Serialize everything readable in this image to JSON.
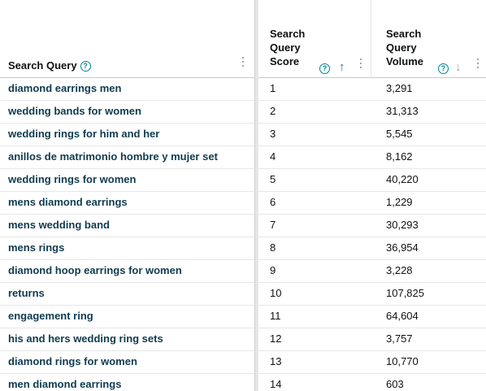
{
  "columns": {
    "query": {
      "label": "Search Query",
      "help_glyph": "?"
    },
    "score": {
      "label": "Search Query Score",
      "help_glyph": "?",
      "sort_glyph": "↑"
    },
    "volume": {
      "label": "Search Query Volume",
      "help_glyph": "?",
      "sort_glyph": "↓"
    }
  },
  "colors": {
    "accent": "#008296",
    "query_text": "#0f3b4f",
    "divider": "#e6e6e6"
  },
  "rows": [
    {
      "query": "diamond earrings men",
      "score": "1",
      "volume": "3,291"
    },
    {
      "query": "wedding bands for women",
      "score": "2",
      "volume": "31,313"
    },
    {
      "query": "wedding rings for him and her",
      "score": "3",
      "volume": "5,545"
    },
    {
      "query": "anillos de matrimonio hombre y mujer set",
      "score": "4",
      "volume": "8,162"
    },
    {
      "query": "wedding rings for women",
      "score": "5",
      "volume": "40,220"
    },
    {
      "query": "mens diamond earrings",
      "score": "6",
      "volume": "1,229"
    },
    {
      "query": "mens wedding band",
      "score": "7",
      "volume": "30,293"
    },
    {
      "query": "mens rings",
      "score": "8",
      "volume": "36,954"
    },
    {
      "query": "diamond hoop earrings for women",
      "score": "9",
      "volume": "3,228"
    },
    {
      "query": "returns",
      "score": "10",
      "volume": "107,825"
    },
    {
      "query": "engagement ring",
      "score": "11",
      "volume": "64,604"
    },
    {
      "query": "his and hers wedding ring sets",
      "score": "12",
      "volume": "3,757"
    },
    {
      "query": "diamond rings for women",
      "score": "13",
      "volume": "10,770"
    },
    {
      "query": "men diamond earrings",
      "score": "14",
      "volume": "603"
    }
  ]
}
